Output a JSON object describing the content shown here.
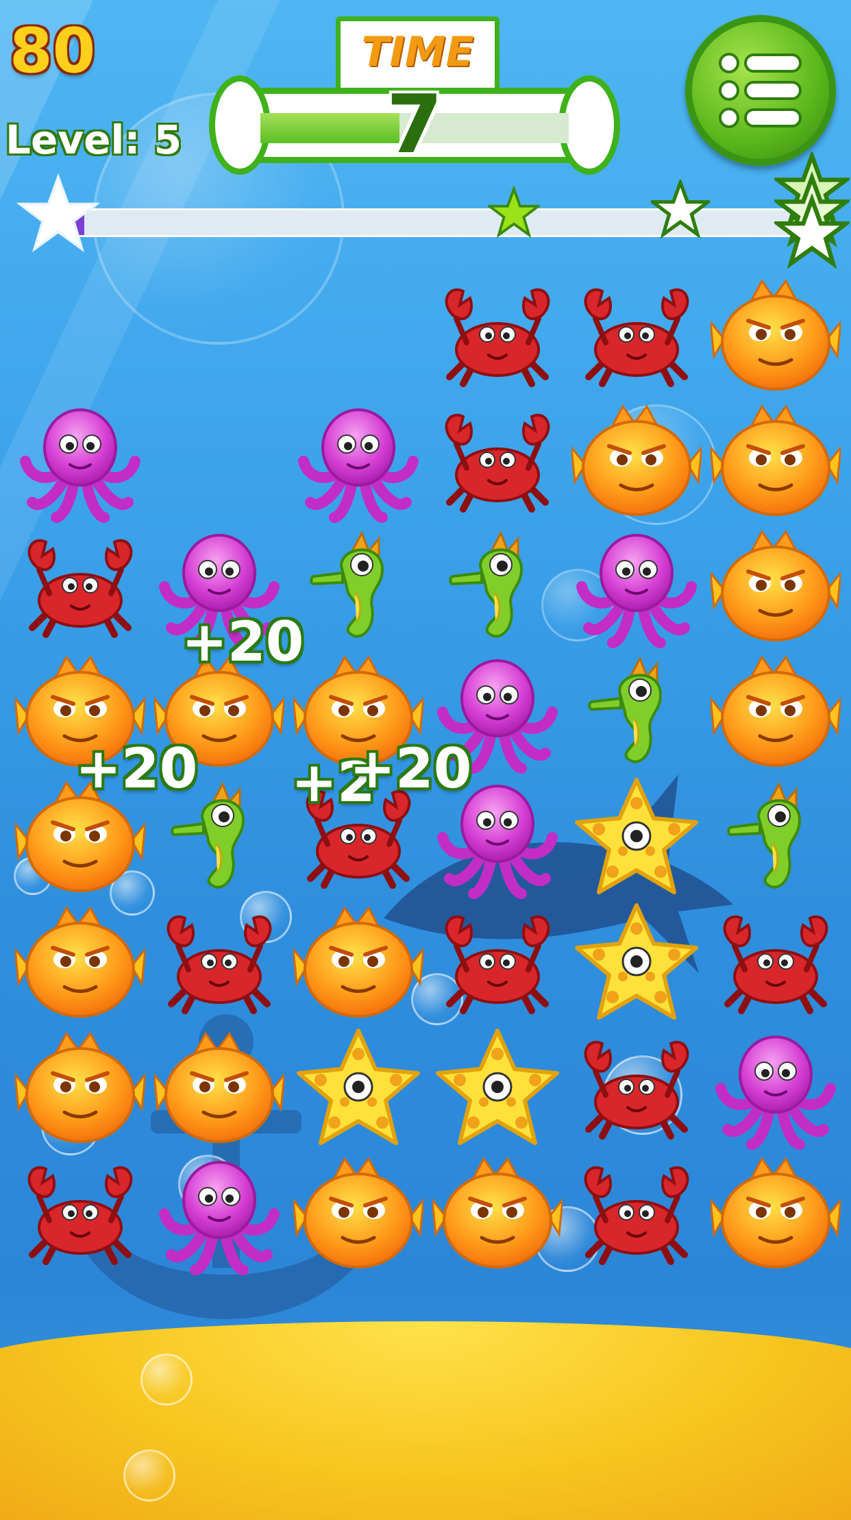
{
  "hud": {
    "score": "80",
    "level": "Level: 5",
    "time_label": "TIME",
    "time_value": "7",
    "time_remaining_fraction": 0.45,
    "menu_icon": "menu-list-icon"
  },
  "progress": {
    "fill_fraction": 0.018,
    "star_icons": [
      "star-1-icon",
      "star-2-icon",
      "star-3-icon"
    ]
  },
  "board": {
    "rows": [
      [
        "",
        "",
        "",
        "crab",
        "crab",
        "pufferfish"
      ],
      [
        "octopus",
        "",
        "octopus",
        "crab",
        "pufferfish",
        "pufferfish"
      ],
      [
        "crab",
        "octopus",
        "seahorse",
        "seahorse",
        "octopus",
        "pufferfish"
      ],
      [
        "pufferfish",
        "pufferfish",
        "pufferfish",
        "octopus",
        "seahorse",
        "pufferfish"
      ],
      [
        "pufferfish",
        "seahorse",
        "crab",
        "octopus",
        "starfish",
        "seahorse"
      ],
      [
        "pufferfish",
        "crab",
        "pufferfish",
        "crab",
        "starfish",
        "crab"
      ],
      [
        "pufferfish",
        "pufferfish",
        "starfish",
        "starfish",
        "crab",
        "octopus"
      ],
      [
        "crab",
        "octopus",
        "pufferfish",
        "pufferfish",
        "crab",
        "pufferfish"
      ]
    ]
  },
  "popups": [
    "+20",
    "+20",
    "+2",
    "+20"
  ],
  "colors": {
    "accent_green": "#3fb11b",
    "score_yellow": "#ffcf1c",
    "progress_purple": "#7b3fd4"
  }
}
